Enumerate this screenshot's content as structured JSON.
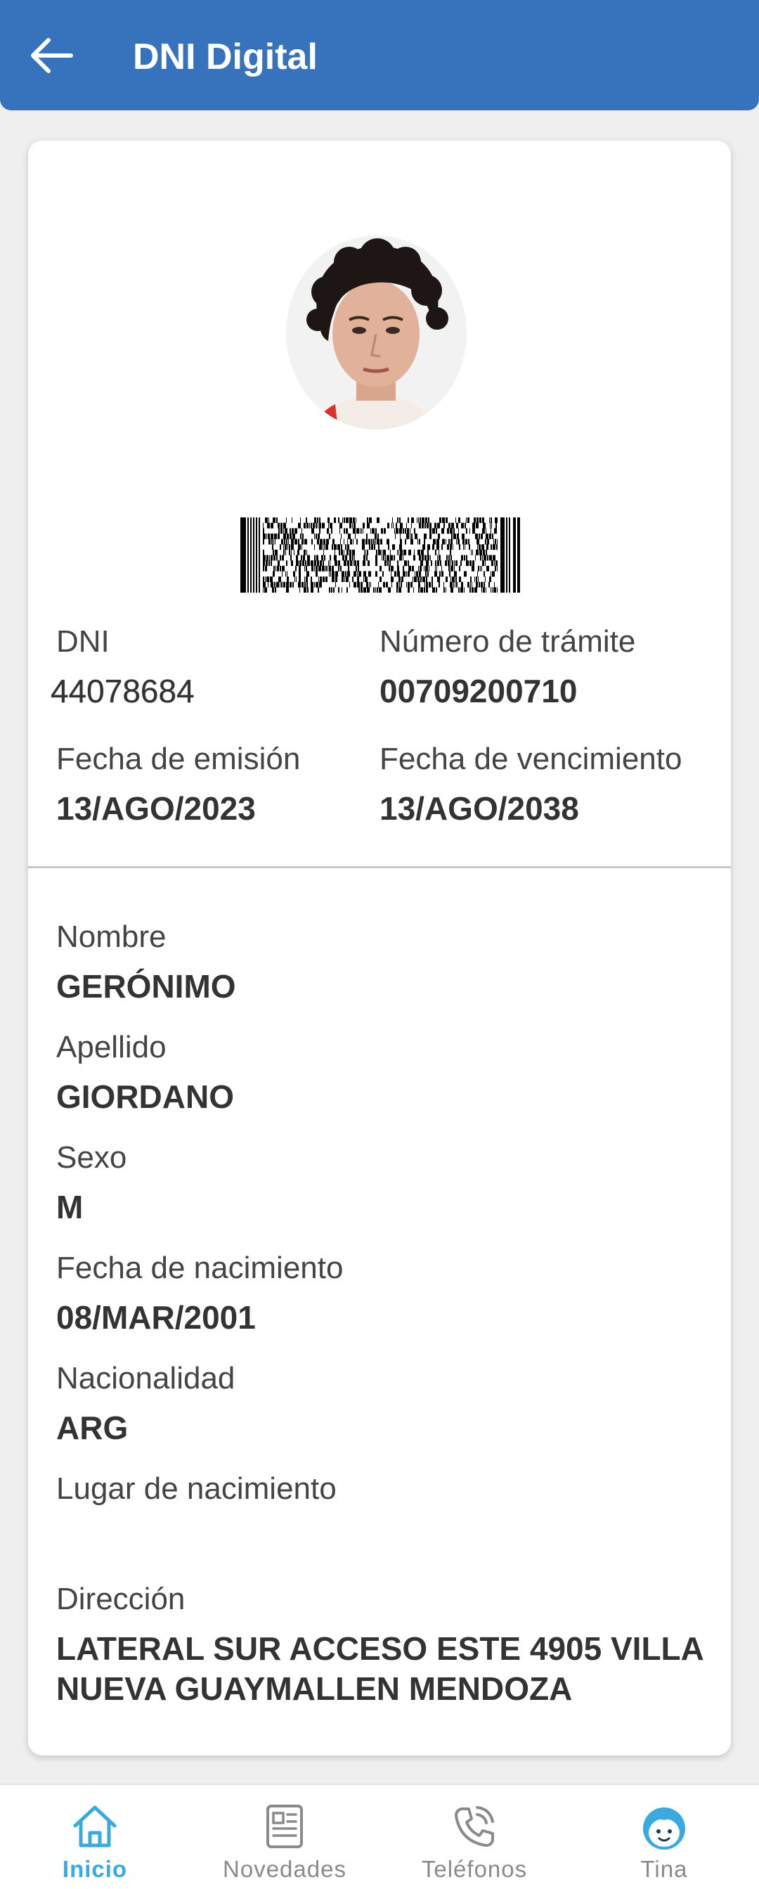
{
  "header": {
    "title": "DNI Digital",
    "back_icon": "arrow-left-icon",
    "bg_color": "#3772bd"
  },
  "card": {
    "photo": "portrait-photo",
    "barcode": "pdf417-barcode",
    "fields": {
      "dni_label": "DNI",
      "dni_value": "44078684",
      "tramite_label": "Número de trámite",
      "tramite_value": "00709200710",
      "emision_label": "Fecha de emisión",
      "emision_value": "13/AGO/2023",
      "vencimiento_label": "Fecha de vencimiento",
      "vencimiento_value": "13/AGO/2038",
      "nombre_label": "Nombre",
      "nombre_value": "GERÓNIMO",
      "apellido_label": "Apellido",
      "apellido_value": "GIORDANO",
      "sexo_label": "Sexo",
      "sexo_value": "M",
      "nacimiento_label": "Fecha de nacimiento",
      "nacimiento_value": "08/MAR/2001",
      "nacionalidad_label": "Nacionalidad",
      "nacionalidad_value": "ARG",
      "lugar_label": "Lugar de nacimiento",
      "lugar_value": "",
      "direccion_label": "Dirección",
      "direccion_line1": "LATERAL SUR ACCESO ESTE 4905 VILLA",
      "direccion_line2": "NUEVA GUAYMALLEN MENDOZA"
    }
  },
  "bottom_nav": {
    "items": [
      {
        "label": "Inicio",
        "icon": "home-icon",
        "active": true
      },
      {
        "label": "Novedades",
        "icon": "newspaper-icon",
        "active": false
      },
      {
        "label": "Teléfonos",
        "icon": "phone-icon",
        "active": false
      },
      {
        "label": "Tina",
        "icon": "tina-avatar-icon",
        "active": false
      }
    ],
    "active_color": "#3aa9e0",
    "inactive_color": "#8a8a8a"
  }
}
